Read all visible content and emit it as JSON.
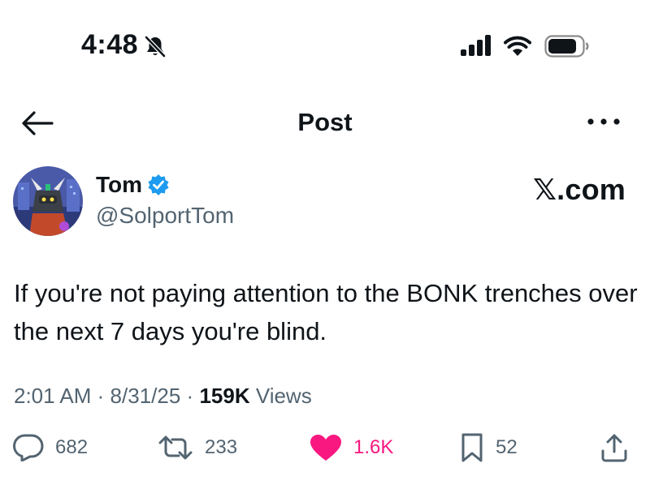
{
  "status_bar": {
    "time": "4:48",
    "icons": [
      "bell-slash-icon",
      "signal-icon",
      "wifi-icon",
      "battery-icon"
    ]
  },
  "header": {
    "back_icon": "arrow-left-icon",
    "title": "Post",
    "more_icon": "more-horizontal-icon"
  },
  "author": {
    "name": "Tom",
    "handle": "@SolportTom",
    "verified": true,
    "avatar": "robot-avatar"
  },
  "brand": "𝕏.com",
  "post": {
    "text": "If you're not paying attention to the BONK trenches over the next 7 days you're blind.",
    "time": "2:01 AM",
    "sep1": "·",
    "date": "8/31/25",
    "sep2": "·",
    "views_count": "159K",
    "views_label": "Views"
  },
  "actions": {
    "replies": "682",
    "reposts": "233",
    "likes": "1.6K",
    "bookmarks": "52"
  },
  "colors": {
    "text": "#0f1419",
    "secondary": "#536471",
    "like": "#f91880",
    "verified": "#1d9bf0"
  }
}
